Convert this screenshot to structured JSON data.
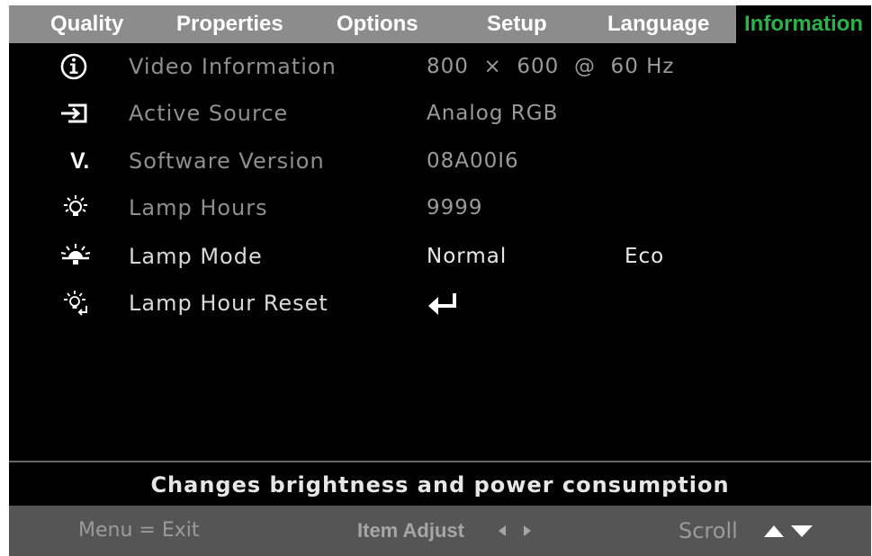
{
  "tabs": [
    {
      "label": "Quality",
      "active": false
    },
    {
      "label": "Properties",
      "active": false
    },
    {
      "label": "Options",
      "active": false
    },
    {
      "label": "Setup",
      "active": false
    },
    {
      "label": "Language",
      "active": false
    },
    {
      "label": "Information",
      "active": true
    }
  ],
  "rows": [
    {
      "icon": "info-icon",
      "label": "Video Information",
      "value": "800  ×  600  @  60 Hz"
    },
    {
      "icon": "source-input-icon",
      "label": "Active Source",
      "value": "Analog RGB"
    },
    {
      "icon": "version-icon",
      "icon_text": "V.",
      "label": "Software Version",
      "value": "08A00I6"
    },
    {
      "icon": "lamp-icon",
      "label": "Lamp Hours",
      "value": "9999"
    },
    {
      "icon": "lamp-mode-icon",
      "label": "Lamp Mode",
      "value": "Normal",
      "value2": "Eco"
    },
    {
      "icon": "lamp-reset-icon",
      "label": "Lamp Hour Reset",
      "value_icon": "enter-key-icon"
    }
  ],
  "hint": "Changes brightness and power consumption",
  "footer": {
    "menu_exit": "Menu = Exit",
    "item_adjust": "Item Adjust",
    "item_adjust_icon": "left-right-arrows-icon",
    "scroll": "Scroll",
    "scroll_icon": "up-down-arrows-icon"
  },
  "colors": {
    "active_tab": "#29b34a",
    "tab_bar": "#8c8c8c",
    "background": "#000000",
    "footer": "#555555"
  }
}
